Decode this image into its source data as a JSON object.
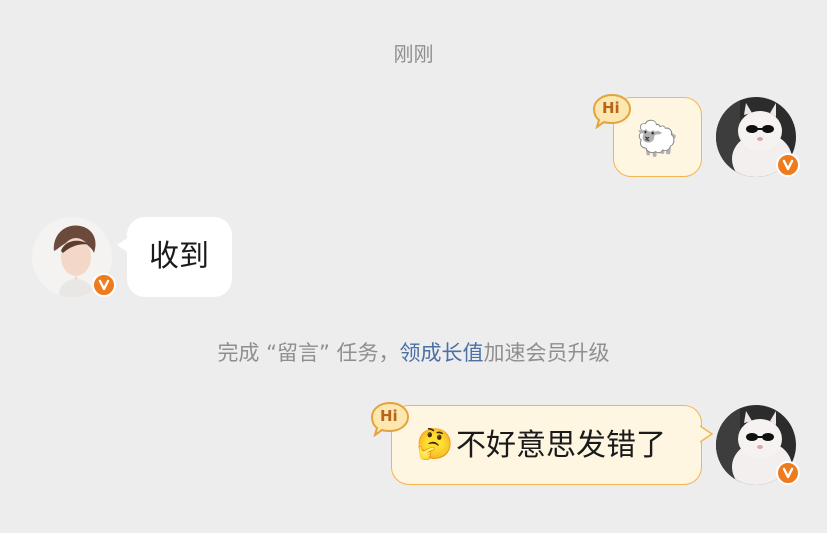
{
  "chat": {
    "timestamp": "刚刚",
    "messages": [
      {
        "sender": "self",
        "emoji": "🐑",
        "hi_label": "Hi"
      },
      {
        "sender": "other",
        "text": "收到"
      },
      {
        "sender": "self",
        "emoji": "🤔",
        "text": "不好意思发错了",
        "hi_label": "Hi"
      }
    ],
    "notice": {
      "prefix": "完成 “留言” 任务，",
      "link": "领成长值",
      "suffix": "加速会员升级"
    }
  },
  "colors": {
    "background": "#ededed",
    "self_bubble": "#fff6e1",
    "self_bubble_border": "#f2b552",
    "other_bubble": "#ffffff",
    "verified_badge": "#f07b1c",
    "link": "#4c6fa5",
    "muted_text": "#8f8f8f"
  }
}
